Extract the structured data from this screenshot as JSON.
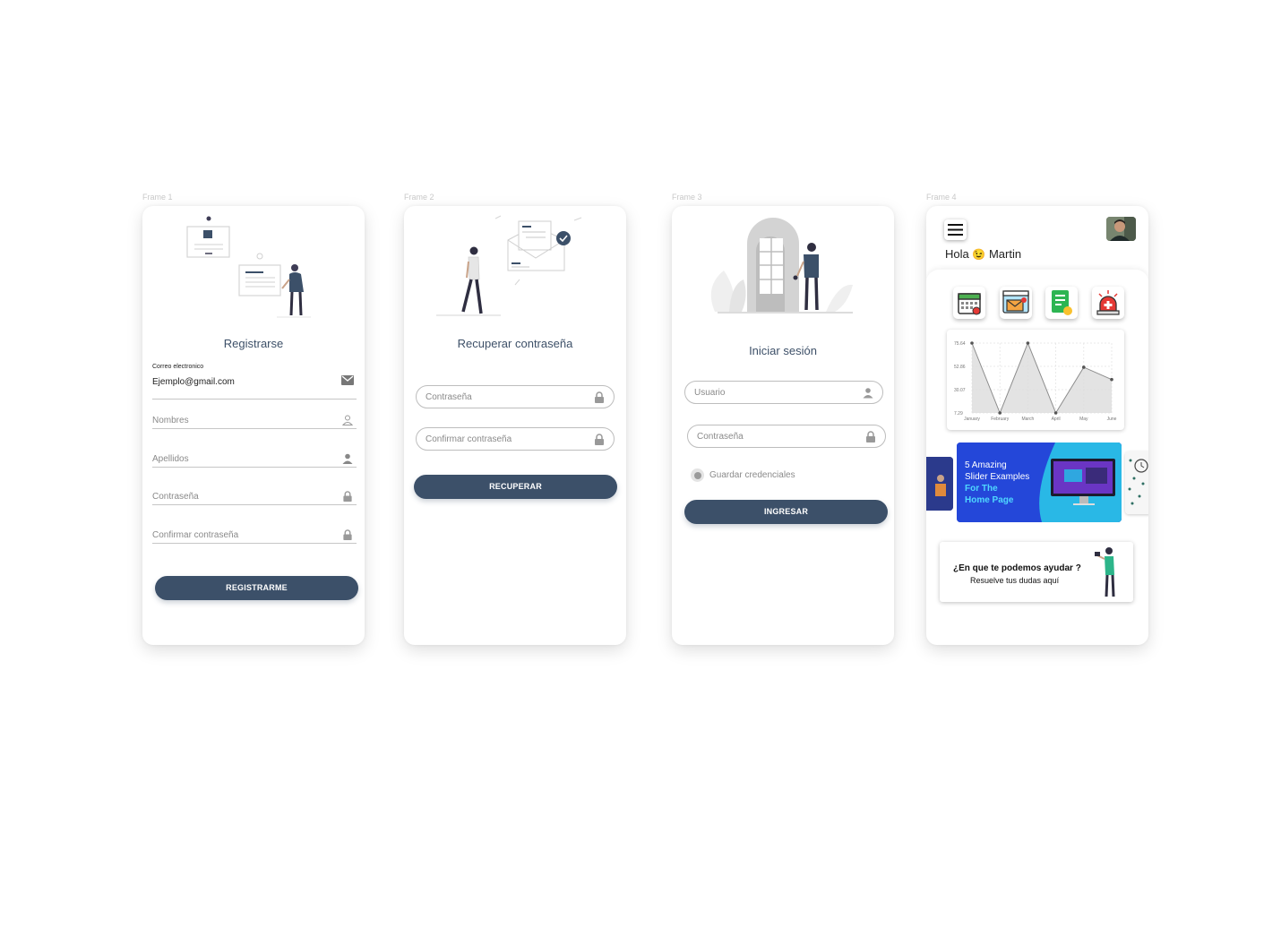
{
  "frames": {
    "f1": {
      "label": "Frame 1",
      "title": "Registrarse",
      "email_caption": "Correo electronico",
      "email_value": "Ejemplo@gmail.com",
      "fields": [
        "Nombres",
        "Apellidos",
        "Contraseña",
        "Confirmar contraseña"
      ],
      "button": "REGISTRARME"
    },
    "f2": {
      "label": "Frame 2",
      "title": "Recuperar contraseña",
      "fields": [
        "Contraseña",
        "Confirmar contraseña"
      ],
      "button": "RECUPERAR"
    },
    "f3": {
      "label": "Frame 3",
      "title": "Iniciar sesión",
      "fields": [
        "Usuario",
        "Contraseña"
      ],
      "remember": "Guardar credenciales",
      "button": "INGRESAR"
    },
    "f4": {
      "label": "Frame 4",
      "greeting": "Hola",
      "emoji": "😉",
      "user": "Martin",
      "quick_icons": [
        "calendar-icon",
        "mail-icon",
        "document-icon",
        "alarm-icon"
      ],
      "banner": {
        "line1": "5 Amazing",
        "line2": "Slider Examples",
        "line3": "For The",
        "line4": "Home Page"
      },
      "help": {
        "title": "¿En que te podemos ayudar ?",
        "subtitle": "Resuelve tus dudas aquí"
      }
    }
  },
  "chart_data": {
    "type": "line",
    "categories": [
      "January",
      "February",
      "March",
      "April",
      "May",
      "June"
    ],
    "values": [
      75.64,
      7.29,
      75.64,
      7.29,
      52.0,
      40.0
    ],
    "y_ticks": [
      "75.64",
      "52.86",
      "30.07",
      "7.29"
    ],
    "ylim": [
      7.29,
      75.64
    ],
    "grid": true,
    "colors": {
      "line": "#8c8c8c",
      "fill": "#dcdcdc",
      "point": "#555555"
    }
  },
  "colors": {
    "primary": "#3c5069",
    "banner_blue": "#1f4bd6",
    "banner_cyan": "#23bde8"
  }
}
